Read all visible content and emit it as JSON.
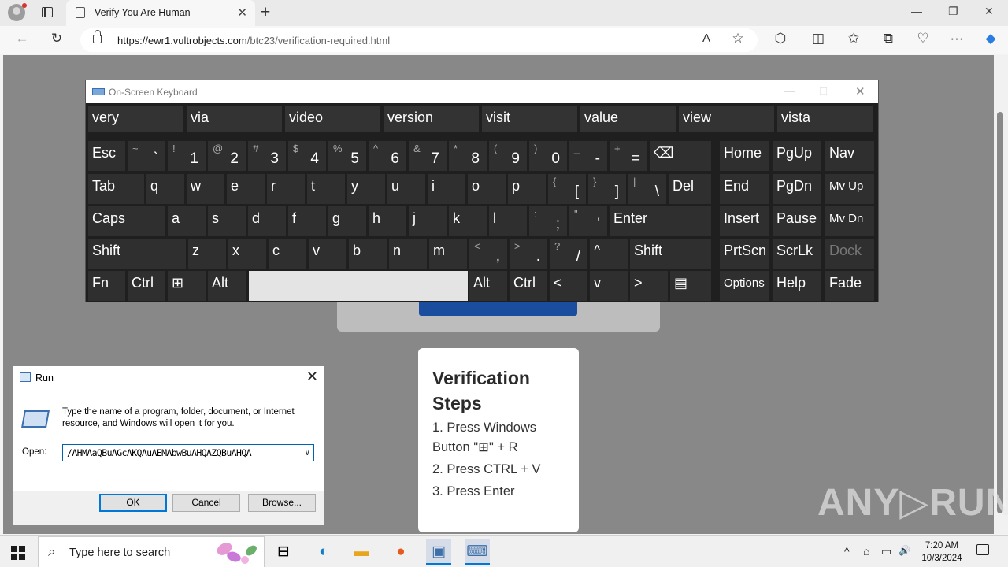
{
  "browser": {
    "tab_title": "Verify You Are Human",
    "tab_close": "✕",
    "new_tab": "+",
    "url_host": "https://ewr1.vultrobjects.com",
    "url_path": "/btc23/verification-required.html",
    "window_controls": {
      "minimize": "—",
      "maximize": "❐",
      "close": "✕"
    },
    "toolbar_icons": {
      "back": "←",
      "reload": "↻",
      "read_aloud": "A",
      "favorite": "☆",
      "extensions": "⬡",
      "split": "◫",
      "favorites": "✩",
      "collections": "⧉",
      "performance": "♡",
      "more": "···",
      "copilot": "◆"
    }
  },
  "page": {
    "steps_title": "Verification Steps",
    "steps": [
      "1. Press Windows Button \"⊞\" + R",
      "2. Press CTRL + V",
      "3. Press Enter"
    ],
    "watermark": "ANY▷RUN"
  },
  "osk": {
    "title": "On-Screen Keyboard",
    "controls": {
      "minimize": "—",
      "maximize": "□",
      "close": "✕"
    },
    "suggestions": [
      "very",
      "via",
      "video",
      "version",
      "visit",
      "value",
      "view",
      "vista"
    ],
    "row1": {
      "esc": "Esc",
      "digits": [
        {
          "sup": "~",
          "sub": "`"
        },
        {
          "sup": "!",
          "sub": "1"
        },
        {
          "sup": "@",
          "sub": "2"
        },
        {
          "sup": "#",
          "sub": "3"
        },
        {
          "sup": "$",
          "sub": "4"
        },
        {
          "sup": "%",
          "sub": "5"
        },
        {
          "sup": "^",
          "sub": "6"
        },
        {
          "sup": "&",
          "sub": "7"
        },
        {
          "sup": "*",
          "sub": "8"
        },
        {
          "sup": "(",
          "sub": "9"
        },
        {
          "sup": ")",
          "sub": "0"
        },
        {
          "sup": "_",
          "sub": "-"
        },
        {
          "sup": "+",
          "sub": "="
        }
      ],
      "backspace": "⌫",
      "nav": [
        "Home",
        "PgUp",
        "Nav"
      ]
    },
    "row2": {
      "tab": "Tab",
      "letters": [
        "q",
        "w",
        "e",
        "r",
        "t",
        "y",
        "u",
        "i",
        "o",
        "p"
      ],
      "brackets": [
        {
          "sup": "{",
          "sub": "["
        },
        {
          "sup": "}",
          "sub": "]"
        },
        {
          "sup": "|",
          "sub": "\\"
        }
      ],
      "del": "Del",
      "nav": [
        "End",
        "PgDn",
        "Mv Up"
      ]
    },
    "row3": {
      "caps": "Caps",
      "letters": [
        "a",
        "s",
        "d",
        "f",
        "g",
        "h",
        "j",
        "k",
        "l"
      ],
      "punct": [
        {
          "sup": ":",
          "sub": ";"
        },
        {
          "sup": "\"",
          "sub": "'"
        }
      ],
      "enter": "Enter",
      "nav": [
        "Insert",
        "Pause",
        "Mv Dn"
      ]
    },
    "row4": {
      "shift": "Shift",
      "letters": [
        "z",
        "x",
        "c",
        "v",
        "b",
        "n",
        "m"
      ],
      "punct": [
        {
          "sup": "<",
          "sub": ","
        },
        {
          "sup": ">",
          "sub": "."
        },
        {
          "sup": "?",
          "sub": "/"
        }
      ],
      "up": "^",
      "shift_r": "Shift",
      "nav": [
        "PrtScn",
        "ScrLk",
        "Dock"
      ]
    },
    "row5": {
      "fn": "Fn",
      "ctrl": "Ctrl",
      "win": "⊞",
      "alt": "Alt",
      "alt_r": "Alt",
      "ctrl_r": "Ctrl",
      "left": "<",
      "down": "v",
      "right": ">",
      "menu": "▤",
      "nav": [
        "Options",
        "Help",
        "Fade"
      ]
    }
  },
  "run_dialog": {
    "title": "Run",
    "close": "✕",
    "description": "Type the name of a program, folder, document, or Internet resource, and Windows will open it for you.",
    "open_label": "Open:",
    "open_value": "/AHMAaQBuAGcAKQAuAEMAbwBuAHQAZQBuAHQA",
    "ok": "OK",
    "cancel": "Cancel",
    "browse": "Browse..."
  },
  "taskbar": {
    "search_placeholder": "Type here to search",
    "clock_time": "7:20 AM",
    "clock_date": "10/3/2024",
    "tray_icons": [
      "^",
      "⌂",
      "▭",
      "🔊"
    ]
  }
}
